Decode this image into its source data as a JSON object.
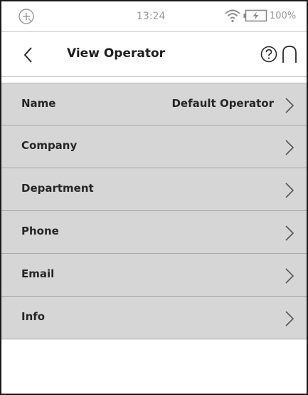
{
  "status_bar": {
    "time": "13:24",
    "battery_percent": "100%",
    "left_icon": "add-circle-icon",
    "wifi_icon": "wifi-icon",
    "battery_icon": "battery-charging-icon"
  },
  "header": {
    "title": "View Operator",
    "back_icon": "chevron-left-icon",
    "help_icon": "help-circle-icon",
    "home_icon": "home-arch-icon"
  },
  "list": {
    "items": [
      {
        "label": "Name",
        "value": "Default Operator"
      },
      {
        "label": "Company",
        "value": ""
      },
      {
        "label": "Department",
        "value": ""
      },
      {
        "label": "Phone",
        "value": ""
      },
      {
        "label": "Email",
        "value": ""
      },
      {
        "label": "Info",
        "value": ""
      }
    ]
  },
  "colors": {
    "row_background": "#d6d6d6",
    "row_divider": "#a9a9a9",
    "text": "#262626",
    "status_text": "#9a9a9a"
  }
}
